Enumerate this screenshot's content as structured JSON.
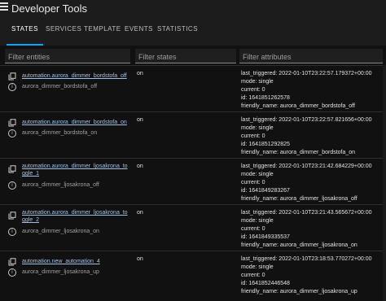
{
  "header": {
    "title": "Developer Tools"
  },
  "tabs": [
    {
      "label": "STATES"
    },
    {
      "label": "SERVICES"
    },
    {
      "label": "TEMPLATE"
    },
    {
      "label": "EVENTS"
    },
    {
      "label": "STATISTICS"
    }
  ],
  "filters": {
    "entities_placeholder": "Filter entities",
    "states_placeholder": "Filter states",
    "attributes_placeholder": "Filter attributes"
  },
  "rows": [
    {
      "entity_id": "automation.aurora_dimmer_bordstofa_off",
      "friendly": "aurora_dimmer_bordstofa_off",
      "state": "on",
      "attrs": [
        "last_triggered: 2022-01-10T23:22:57.179372+00:00",
        "mode: single",
        "current: 0",
        "id: 1641851262578",
        "friendly_name: aurora_dimmer_bordstofa_off"
      ]
    },
    {
      "entity_id": "automation.aurora_dimmer_bordstofa_on",
      "friendly": "aurora_dimmer_bordstofa_on",
      "state": "on",
      "attrs": [
        "last_triggered: 2022-01-10T23:22:57.821656+00:00",
        "mode: single",
        "current: 0",
        "id: 1641851292825",
        "friendly_name: aurora_dimmer_bordstofa_on"
      ]
    },
    {
      "entity_id": "automation.aurora_dimmer_ljosakrona_toggle_1",
      "entity_line1": "automation.aurora_dimmer_ljosakrona_to",
      "entity_line2": "ggle_1",
      "friendly": "aurora_dimmer_ljosakrona_off",
      "state": "on",
      "attrs": [
        "last_triggered: 2022-01-10T23:21:42.684229+00:00",
        "mode: single",
        "current: 0",
        "id: 1641849283267",
        "friendly_name: aurora_dimmer_ljosakrona_off"
      ]
    },
    {
      "entity_id": "automation.aurora_dimmer_ljosakrona_toggle_2",
      "entity_line1": "automation.aurora_dimmer_ljosakrona_to",
      "entity_line2": "ggle_2",
      "friendly": "aurora_dimmer_ljosakrona_on",
      "state": "on",
      "attrs": [
        "last_triggered: 2022-01-10T23:21:43.565672+00:00",
        "mode: single",
        "current: 0",
        "id: 1641849335537",
        "friendly_name: aurora_dimmer_ljosakrona_on"
      ]
    },
    {
      "entity_id": "automation.new_automation_4",
      "friendly": "aurora_dimmer_ljosakrona_up",
      "state": "on",
      "attrs": [
        "last_triggered: 2022-01-10T23:18:53.770272+00:00",
        "mode: single",
        "current: 0",
        "id: 1641852446548",
        "friendly_name: aurora_dimmer_ljosakrona_up"
      ]
    }
  ],
  "colors": {
    "accent": "#03a9f4",
    "link": "#9ec1e6",
    "background": "#111111"
  },
  "icons": {
    "menu": "menu-icon",
    "entity": "content-copy-icon",
    "info": "info-circle-icon"
  }
}
